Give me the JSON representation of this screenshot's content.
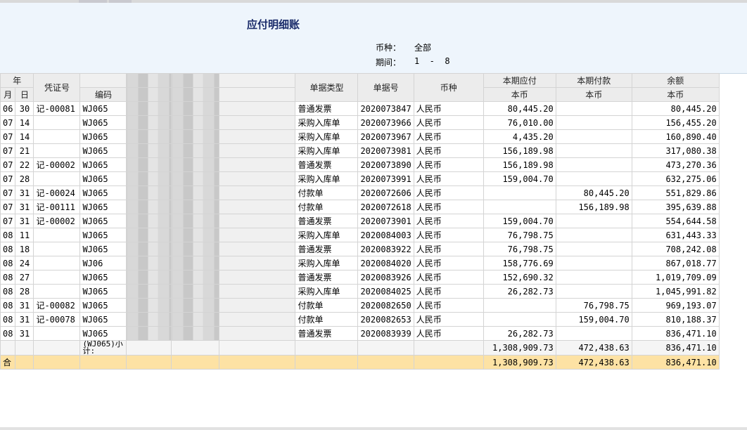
{
  "report": {
    "title": "应付明细账",
    "currency_label": "币种：",
    "currency_value": "全部",
    "period_label": "期间：",
    "period_value": "1  -  8"
  },
  "columns": {
    "year": "年",
    "month": "月",
    "day": "日",
    "voucher": "凭证号",
    "code": "编码",
    "doc_type": "单据类型",
    "doc_no": "单据号",
    "currency": "币种",
    "payable_group": "本期应付",
    "paid_group": "本期付款",
    "balance_group": "余额",
    "base_currency": "本币"
  },
  "rows": [
    {
      "m": "06",
      "d": "30",
      "voucher": "记-00081",
      "code": "WJ065",
      "type": "普通发票",
      "no": "2020073847",
      "cur": "人民币",
      "payable": "80,445.20",
      "paid": "",
      "balance": "80,445.20"
    },
    {
      "m": "07",
      "d": "14",
      "voucher": "",
      "code": "WJ065",
      "type": "采购入库单",
      "no": "2020073966",
      "cur": "人民币",
      "payable": "76,010.00",
      "paid": "",
      "balance": "156,455.20"
    },
    {
      "m": "07",
      "d": "14",
      "voucher": "",
      "code": "WJ065",
      "type": "采购入库单",
      "no": "2020073967",
      "cur": "人民币",
      "payable": "4,435.20",
      "paid": "",
      "balance": "160,890.40"
    },
    {
      "m": "07",
      "d": "21",
      "voucher": "",
      "code": "WJ065",
      "type": "采购入库单",
      "no": "2020073981",
      "cur": "人民币",
      "payable": "156,189.98",
      "paid": "",
      "balance": "317,080.38"
    },
    {
      "m": "07",
      "d": "22",
      "voucher": "记-00002",
      "code": "WJ065",
      "type": "普通发票",
      "no": "2020073890",
      "cur": "人民币",
      "payable": "156,189.98",
      "paid": "",
      "balance": "473,270.36"
    },
    {
      "m": "07",
      "d": "28",
      "voucher": "",
      "code": "WJ065",
      "type": "采购入库单",
      "no": "2020073991",
      "cur": "人民币",
      "payable": "159,004.70",
      "paid": "",
      "balance": "632,275.06"
    },
    {
      "m": "07",
      "d": "31",
      "voucher": "记-00024",
      "code": "WJ065",
      "type": "付款单",
      "no": "2020072606",
      "cur": "人民币",
      "payable": "",
      "paid": "80,445.20",
      "balance": "551,829.86"
    },
    {
      "m": "07",
      "d": "31",
      "voucher": "记-00111",
      "code": "WJ065",
      "type": "付款单",
      "no": "2020072618",
      "cur": "人民币",
      "payable": "",
      "paid": "156,189.98",
      "balance": "395,639.88"
    },
    {
      "m": "07",
      "d": "31",
      "voucher": "记-00002",
      "code": "WJ065",
      "type": "普通发票",
      "no": "2020073901",
      "cur": "人民币",
      "payable": "159,004.70",
      "paid": "",
      "balance": "554,644.58"
    },
    {
      "m": "08",
      "d": "11",
      "voucher": "",
      "code": "WJ065",
      "type": "采购入库单",
      "no": "2020084003",
      "cur": "人民币",
      "payable": "76,798.75",
      "paid": "",
      "balance": "631,443.33"
    },
    {
      "m": "08",
      "d": "18",
      "voucher": "",
      "code": "WJ065",
      "type": "普通发票",
      "no": "2020083922",
      "cur": "人民币",
      "payable": "76,798.75",
      "paid": "",
      "balance": "708,242.08"
    },
    {
      "m": "08",
      "d": "24",
      "voucher": "",
      "code": "WJ06",
      "type": "采购入库单",
      "no": "2020084020",
      "cur": "人民币",
      "payable": "158,776.69",
      "paid": "",
      "balance": "867,018.77"
    },
    {
      "m": "08",
      "d": "27",
      "voucher": "",
      "code": "WJ065",
      "type": "普通发票",
      "no": "2020083926",
      "cur": "人民币",
      "payable": "152,690.32",
      "paid": "",
      "balance": "1,019,709.09"
    },
    {
      "m": "08",
      "d": "28",
      "voucher": "",
      "code": "WJ065",
      "type": "采购入库单",
      "no": "2020084025",
      "cur": "人民币",
      "payable": "26,282.73",
      "paid": "",
      "balance": "1,045,991.82"
    },
    {
      "m": "08",
      "d": "31",
      "voucher": "记-00082",
      "code": "WJ065",
      "type": "付款单",
      "no": "2020082650",
      "cur": "人民币",
      "payable": "",
      "paid": "76,798.75",
      "balance": "969,193.07"
    },
    {
      "m": "08",
      "d": "31",
      "voucher": "记-00078",
      "code": "WJ065",
      "type": "付款单",
      "no": "2020082653",
      "cur": "人民币",
      "payable": "",
      "paid": "159,004.70",
      "balance": "810,188.37"
    },
    {
      "m": "08",
      "d": "31",
      "voucher": "",
      "code": "WJ065",
      "type": "普通发票",
      "no": "2020083939",
      "cur": "人民币",
      "payable": "26,282.73",
      "paid": "",
      "balance": "836,471.10"
    }
  ],
  "subtotal": {
    "code": "(WJ065)小计:",
    "payable": "1,308,909.73",
    "paid": "472,438.63",
    "balance": "836,471.10"
  },
  "total": {
    "label": "合",
    "payable": "1,308,909.73",
    "paid": "472,438.63",
    "balance": "836,471.10"
  }
}
